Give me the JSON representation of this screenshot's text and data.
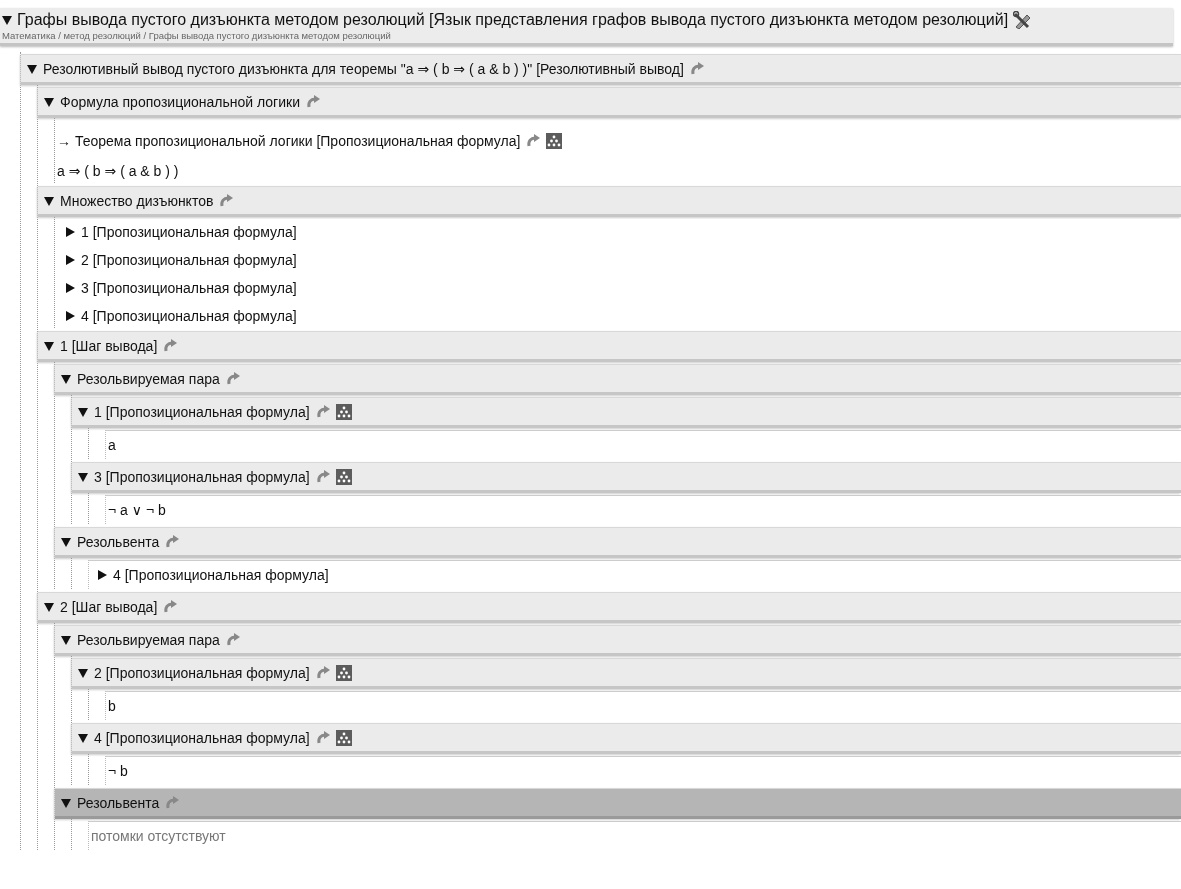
{
  "page": {
    "title": "Графы вывода пустого дизъюнкта методом резолюций [Язык представления графов вывода пустого дизъюнкта методом резолюций]",
    "expanded": true,
    "breadcrumb": "Математика / метод резолюций / Графы вывода пустого дизъюнкта методом резолюций"
  },
  "tree": [
    {
      "kind": "section",
      "label": "Резолютивный вывод пустого дизъюнкта для теоремы \"a ⇒ ( b ⇒ ( a & b ) )\" [Резолютивный вывод]",
      "expanded": true,
      "selected": false,
      "graph": false,
      "children": [
        {
          "kind": "section",
          "label": "Формула пропозициональной логики",
          "expanded": true,
          "selected": false,
          "graph": false,
          "children": [
            {
              "kind": "link",
              "label": "→ Теорема пропозициональной логики [Пропозициональная формула]",
              "graph": true
            },
            {
              "kind": "formula",
              "text": "a ⇒ ( b ⇒ ( a & b ) )"
            }
          ]
        },
        {
          "kind": "section",
          "label": "Множество дизъюнктов",
          "expanded": true,
          "selected": false,
          "graph": false,
          "children": [
            {
              "kind": "item",
              "label": "1 [Пропозициональная формула]",
              "expanded": false
            },
            {
              "kind": "item",
              "label": "2 [Пропозициональная формула]",
              "expanded": false
            },
            {
              "kind": "item",
              "label": "3 [Пропозициональная формула]",
              "expanded": false
            },
            {
              "kind": "item",
              "label": "4 [Пропозициональная формула]",
              "expanded": false
            }
          ]
        },
        {
          "kind": "section",
          "label": "1 [Шаг вывода]",
          "expanded": true,
          "selected": false,
          "graph": false,
          "children": [
            {
              "kind": "section",
              "label": "Резольвируемая пара",
              "expanded": true,
              "selected": false,
              "graph": false,
              "children": [
                {
                  "kind": "section",
                  "label": "1 [Пропозициональная формула]",
                  "expanded": true,
                  "selected": false,
                  "graph": true,
                  "children": [
                    {
                      "kind": "value",
                      "text": "a"
                    }
                  ]
                },
                {
                  "kind": "section",
                  "label": "3 [Пропозициональная формула]",
                  "expanded": true,
                  "selected": false,
                  "graph": true,
                  "children": [
                    {
                      "kind": "value",
                      "text": "¬ a ∨ ¬ b"
                    }
                  ]
                }
              ]
            },
            {
              "kind": "section",
              "label": "Резольвента",
              "expanded": true,
              "selected": false,
              "graph": false,
              "children": [
                {
                  "kind": "boxitem",
                  "label": "4 [Пропозициональная формула]",
                  "expanded": false
                }
              ]
            }
          ]
        },
        {
          "kind": "section",
          "label": "2 [Шаг вывода]",
          "expanded": true,
          "selected": false,
          "graph": false,
          "children": [
            {
              "kind": "section",
              "label": "Резольвируемая пара",
              "expanded": true,
              "selected": false,
              "graph": false,
              "children": [
                {
                  "kind": "section",
                  "label": "2 [Пропозициональная формула]",
                  "expanded": true,
                  "selected": false,
                  "graph": true,
                  "children": [
                    {
                      "kind": "value",
                      "text": "b"
                    }
                  ]
                },
                {
                  "kind": "section",
                  "label": "4 [Пропозициональная формула]",
                  "expanded": true,
                  "selected": false,
                  "graph": true,
                  "children": [
                    {
                      "kind": "value",
                      "text": "¬ b"
                    }
                  ]
                }
              ]
            },
            {
              "kind": "section",
              "label": "Резольвента",
              "expanded": true,
              "selected": true,
              "graph": false,
              "children": [
                {
                  "kind": "note",
                  "text": "потомки отсутствуют"
                }
              ]
            }
          ]
        }
      ]
    }
  ]
}
